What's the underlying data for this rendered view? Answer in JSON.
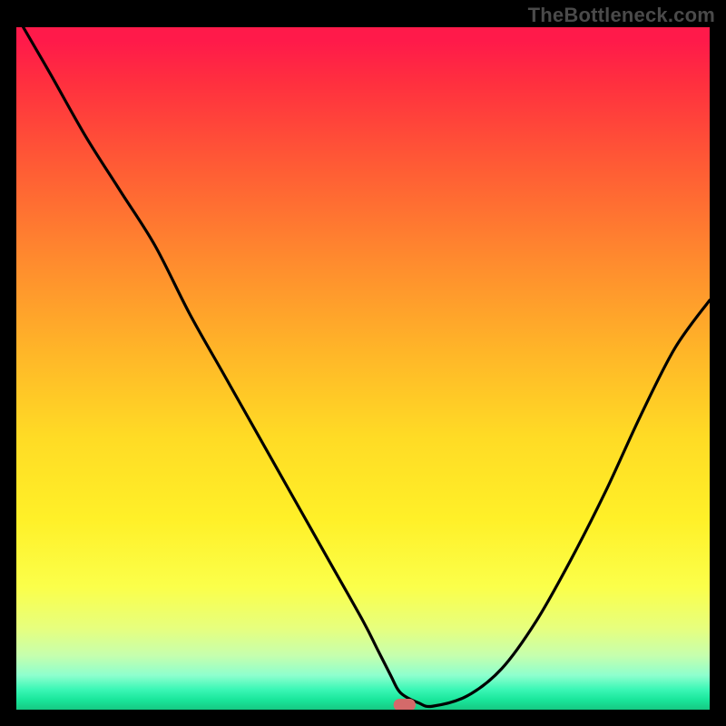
{
  "watermark": "TheBottleneck.com",
  "chart_data": {
    "type": "line",
    "title": "",
    "xlabel": "",
    "ylabel": "",
    "xlim": [
      0,
      100
    ],
    "ylim": [
      0,
      100
    ],
    "grid": false,
    "series": [
      {
        "name": "bottleneck-curve",
        "stroke": "#000000",
        "stroke_width": 3.2,
        "x": [
          1,
          5,
          10,
          15,
          20,
          25,
          30,
          35,
          40,
          45,
          50,
          52,
          54,
          55,
          56,
          58,
          60,
          65,
          70,
          75,
          80,
          85,
          90,
          95,
          100
        ],
        "values": [
          100,
          93,
          84,
          76,
          68,
          58,
          49,
          40,
          31,
          22,
          13,
          9,
          5,
          3,
          2,
          1,
          0.5,
          2,
          6,
          13,
          22,
          32,
          43,
          53,
          60
        ]
      }
    ],
    "marker": {
      "name": "optimal-point",
      "x": 56,
      "y": 0.7,
      "width": 3.2,
      "height": 1.8,
      "fill": "#d46a6a",
      "rx": 1.2
    },
    "gradient_stops": [
      {
        "pct": 0,
        "color": "#ff1a4a"
      },
      {
        "pct": 8,
        "color": "#ff2f3f"
      },
      {
        "pct": 20,
        "color": "#ff5a35"
      },
      {
        "pct": 34,
        "color": "#ff8a2e"
      },
      {
        "pct": 48,
        "color": "#ffb728"
      },
      {
        "pct": 60,
        "color": "#ffdb25"
      },
      {
        "pct": 72,
        "color": "#fff028"
      },
      {
        "pct": 82,
        "color": "#fbff4a"
      },
      {
        "pct": 88,
        "color": "#e7ff7d"
      },
      {
        "pct": 92,
        "color": "#c7ffad"
      },
      {
        "pct": 95,
        "color": "#8dffce"
      },
      {
        "pct": 97,
        "color": "#3cf7b6"
      },
      {
        "pct": 98.5,
        "color": "#1ae79c"
      },
      {
        "pct": 100,
        "color": "#16c882"
      }
    ]
  }
}
